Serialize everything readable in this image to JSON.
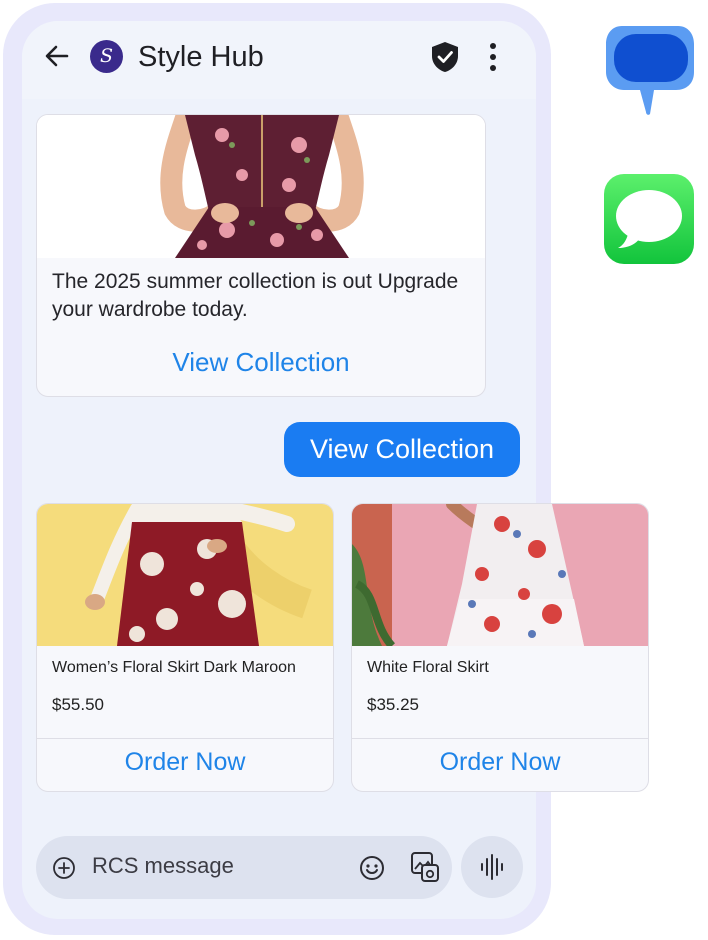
{
  "header": {
    "avatar_letter": "S",
    "title": "Style Hub",
    "back_icon": "arrow-left-icon",
    "verified_icon": "shield-check-icon",
    "menu_icon": "more-vertical-icon"
  },
  "promo_card": {
    "text": "The 2025 summer collection is out Upgrade your wardrobe today.",
    "cta": "View Collection"
  },
  "reply": "View Collection",
  "products": [
    {
      "name": "Women’s Floral Skirt Dark Maroon",
      "price": "$55.50",
      "cta": "Order Now"
    },
    {
      "name": "White Floral Skirt",
      "price": "$35.25",
      "cta": "Order Now"
    }
  ],
  "composer": {
    "placeholder": "RCS message"
  },
  "colors": {
    "accent": "#1f84e8",
    "bubble": "#1a7cf2",
    "avatar": "#3a2a8c",
    "frame": "#e8e8fb"
  }
}
